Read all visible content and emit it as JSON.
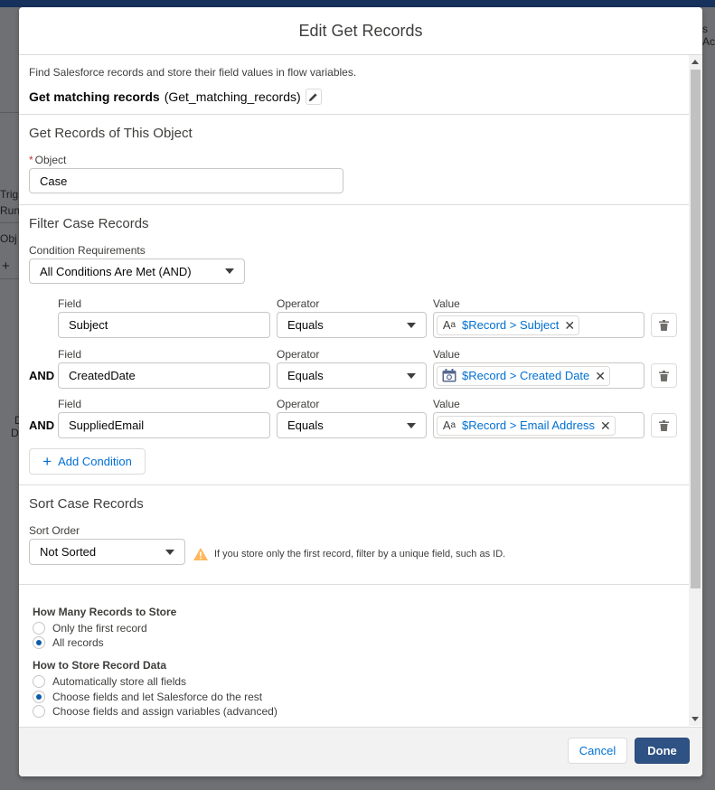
{
  "background": {
    "fragments": [
      "Trig",
      "Run",
      "Obj",
      "+",
      "D",
      "D",
      "s Ac"
    ]
  },
  "modal": {
    "title": "Edit Get Records",
    "description": "Find Salesforce records and store their field values in flow variables.",
    "element_label": "Get matching records",
    "element_api_name": "(Get_matching_records)",
    "object_section": {
      "title": "Get Records of This Object",
      "object_label": "Object",
      "object_value": "Case"
    },
    "filter_section": {
      "title": "Filter Case Records",
      "condition_label": "Condition Requirements",
      "condition_value": "All Conditions Are Met (AND)",
      "field_label": "Field",
      "operator_label": "Operator",
      "value_label": "Value",
      "conditions": [
        {
          "prefix": "",
          "field": "Subject",
          "operator": "Equals",
          "value": "$Record > Subject",
          "value_icon": "text-icon"
        },
        {
          "prefix": "AND",
          "field": "CreatedDate",
          "operator": "Equals",
          "value": "$Record > Created Date",
          "value_icon": "calendar-icon"
        },
        {
          "prefix": "AND",
          "field": "SuppliedEmail",
          "operator": "Equals",
          "value": "$Record > Email Address",
          "value_icon": "text-icon"
        }
      ],
      "add_condition_label": "Add Condition"
    },
    "sort_section": {
      "title": "Sort Case Records",
      "sort_label": "Sort Order",
      "sort_value": "Not Sorted",
      "warning": "If you store only the first record, filter by a unique field, such as ID."
    },
    "store_section": {
      "how_many_title": "How Many Records to Store",
      "how_many_options": [
        {
          "label": "Only the first record",
          "checked": false
        },
        {
          "label": "All records",
          "checked": true
        }
      ],
      "how_store_title": "How to Store Record Data",
      "how_store_options": [
        {
          "label": "Automatically store all fields",
          "checked": false
        },
        {
          "label": "Choose fields and let Salesforce do the rest",
          "checked": true
        },
        {
          "label": "Choose fields and assign variables (advanced)",
          "checked": false
        }
      ]
    },
    "footer": {
      "cancel_label": "Cancel",
      "done_label": "Done"
    }
  },
  "colors": {
    "brand_button": "#2e5283",
    "link_blue": "#0070d2",
    "warning": "#ffb75d",
    "required": "#c23934"
  }
}
